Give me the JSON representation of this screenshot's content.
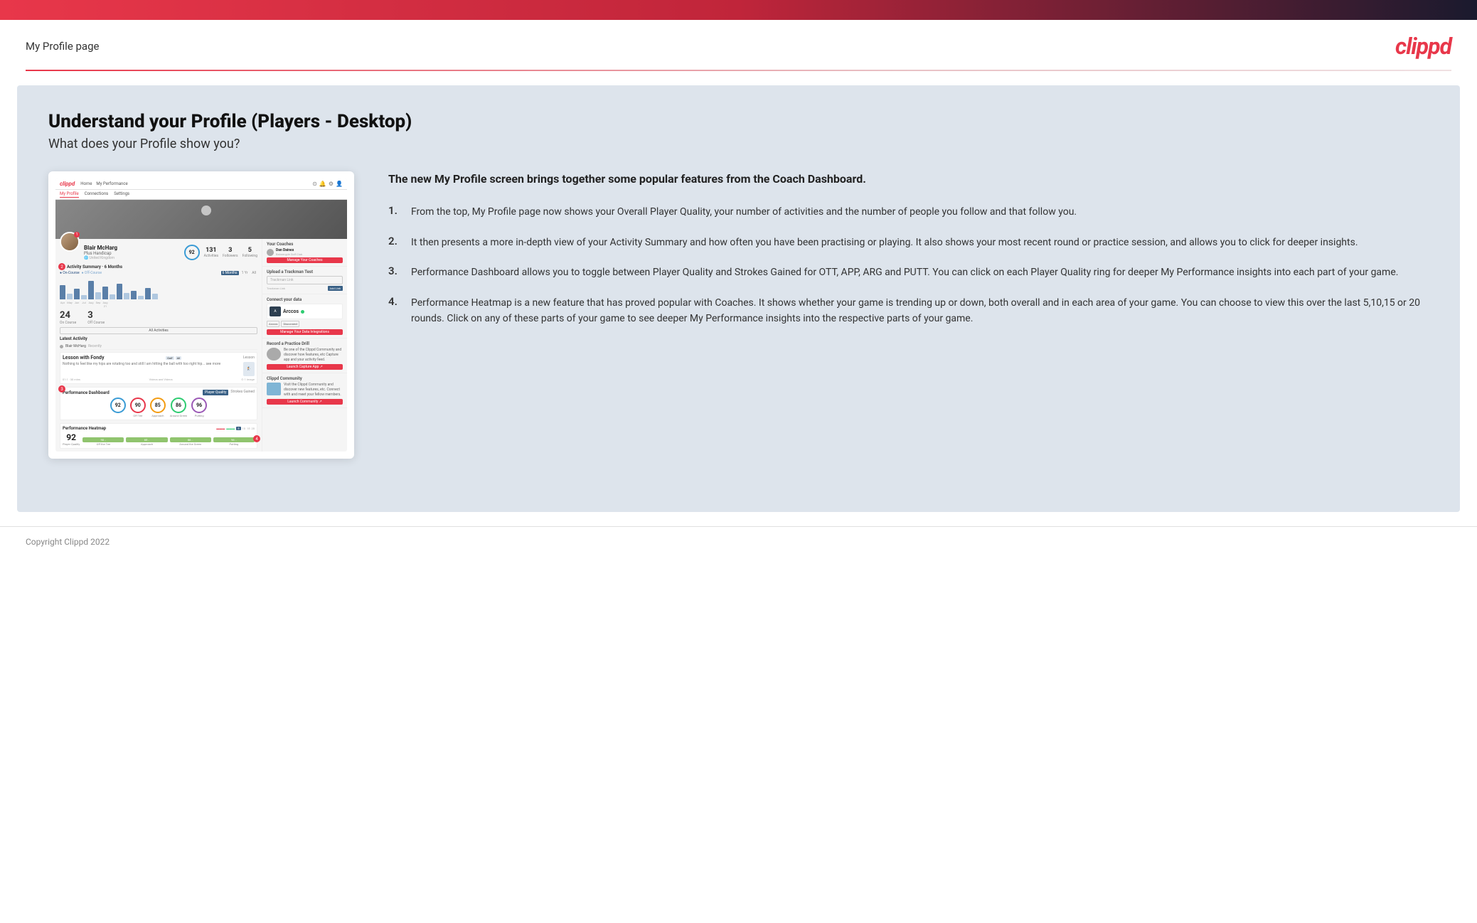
{
  "topbar": {},
  "header": {
    "title": "My Profile page",
    "logo": "clippd"
  },
  "main": {
    "heading": "Understand your Profile (Players - Desktop)",
    "subheading": "What does your Profile show you?",
    "right_intro": "The new My Profile screen brings together some popular features from the Coach Dashboard.",
    "list_items": [
      {
        "number": "1.",
        "text": "From the top, My Profile page now shows your Overall Player Quality, your number of activities and the number of people you follow and that follow you."
      },
      {
        "number": "2.",
        "text": "It then presents a more in-depth view of your Activity Summary and how often you have been practising or playing. It also shows your most recent round or practice session, and allows you to click for deeper insights."
      },
      {
        "number": "3.",
        "text": "Performance Dashboard allows you to toggle between Player Quality and Strokes Gained for OTT, APP, ARG and PUTT. You can click on each Player Quality ring for deeper My Performance insights into each part of your game."
      },
      {
        "number": "4.",
        "text": "Performance Heatmap is a new feature that has proved popular with Coaches. It shows whether your game is trending up or down, both overall and in each area of your game. You can choose to view this over the last 5,10,15 or 20 rounds. Click on any of these parts of your game to see deeper My Performance insights into the respective parts of your game."
      }
    ]
  },
  "mockup": {
    "nav_links": [
      "Home",
      "My Performance"
    ],
    "sub_nav": [
      "My Profile",
      "Connections",
      "Settings"
    ],
    "profile": {
      "name": "Blair McHarg",
      "handicap": "Plus Handicap",
      "quality": "92",
      "activities": "131",
      "followers": "3",
      "following": "5"
    },
    "activity": {
      "title": "Activity Summary · 6 Months",
      "on_course": "24",
      "off_course": "3"
    },
    "coach": {
      "title": "Your Coaches",
      "name": "Dan Daines",
      "club": "Balmergyle Golf Club",
      "btn": "Manage Your Coaches"
    },
    "trackman": {
      "title": "Upload a Trackman Test",
      "placeholder": "Trackman Link",
      "btn": "Add Link"
    },
    "connect": {
      "title": "Connect your data",
      "app_name": "Arccos"
    },
    "practice": {
      "title": "Record a Practice Drill",
      "btn": "Launch Capture App"
    },
    "community": {
      "title": "Clippd Community",
      "btn": "Launch Community"
    },
    "lesson": {
      "title": "Lesson with Fondy",
      "subtitle": "Lesson",
      "duration": "01:1 · 30 mins",
      "media": "1 Image"
    },
    "performance": {
      "title": "Performance Dashboard",
      "toggle": [
        "Player Quality",
        "Strokes Gained"
      ],
      "rings": [
        {
          "label": "",
          "value": "92",
          "color": "#3a9bd5"
        },
        {
          "label": "Off the Tee",
          "value": "90",
          "color": "#e8374a"
        },
        {
          "label": "Approach",
          "value": "85",
          "color": "#f39c12"
        },
        {
          "label": "Around Green",
          "value": "86",
          "color": "#2ecc71"
        },
        {
          "label": "Putting",
          "value": "96",
          "color": "#9b59b6"
        }
      ]
    },
    "heatmap": {
      "title": "Performance Heatmap",
      "overall": "92",
      "cells": [
        {
          "label": "Off the Tee",
          "value": "90",
          "color": "#90c46e"
        },
        {
          "label": "Approach",
          "value": "85",
          "color": "#90c46e"
        },
        {
          "label": "Around Green",
          "value": "86",
          "color": "#90c46e"
        },
        {
          "label": "Putting",
          "value": "96",
          "color": "#90c46e"
        }
      ]
    }
  },
  "footer": {
    "copyright": "Copyright Clippd 2022"
  }
}
